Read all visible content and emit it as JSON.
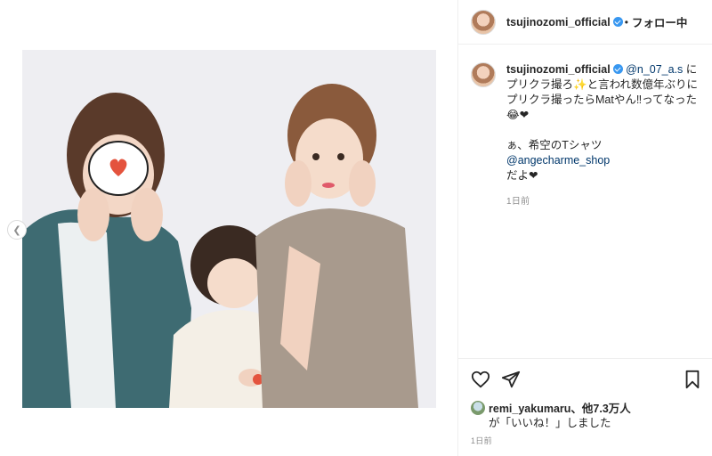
{
  "post": {
    "username": "tsujinozomi_official",
    "follow_status": "フォロー中",
    "header_separator": "•",
    "caption": {
      "mention_handle": "@n_07_a.s",
      "text_line1": " にプリクラ撮ろ",
      "text_line2": "と言われ数億年ぶりにプリクラ撮ったらMatやん‼ってなった",
      "text2_prefix": "ぁ、希空のTシャツ ",
      "shop_mention": "@angecharme_shop",
      "text2_suffix": "だよ❤",
      "emoji_sparkle": "✨",
      "emoji_hearts": "😂❤"
    },
    "caption_time": "1日前",
    "likes": {
      "user": "remi_yakumaru",
      "others": "、他7.3万人",
      "suffix": "が「いいね！」しました"
    },
    "post_time": "1日前"
  },
  "photo": {
    "description_colors": {
      "background": "#eeeef2",
      "left_cardigan": "#3e6b72",
      "right_top": "#a89a8d",
      "child_shirt": "#f4efe6",
      "hair": "#5a3a2a"
    },
    "sticker": "heart-sticker"
  },
  "icons": {
    "prev": "chevron-left-icon",
    "like": "heart-icon",
    "share": "paper-plane-icon",
    "save": "bookmark-icon"
  }
}
